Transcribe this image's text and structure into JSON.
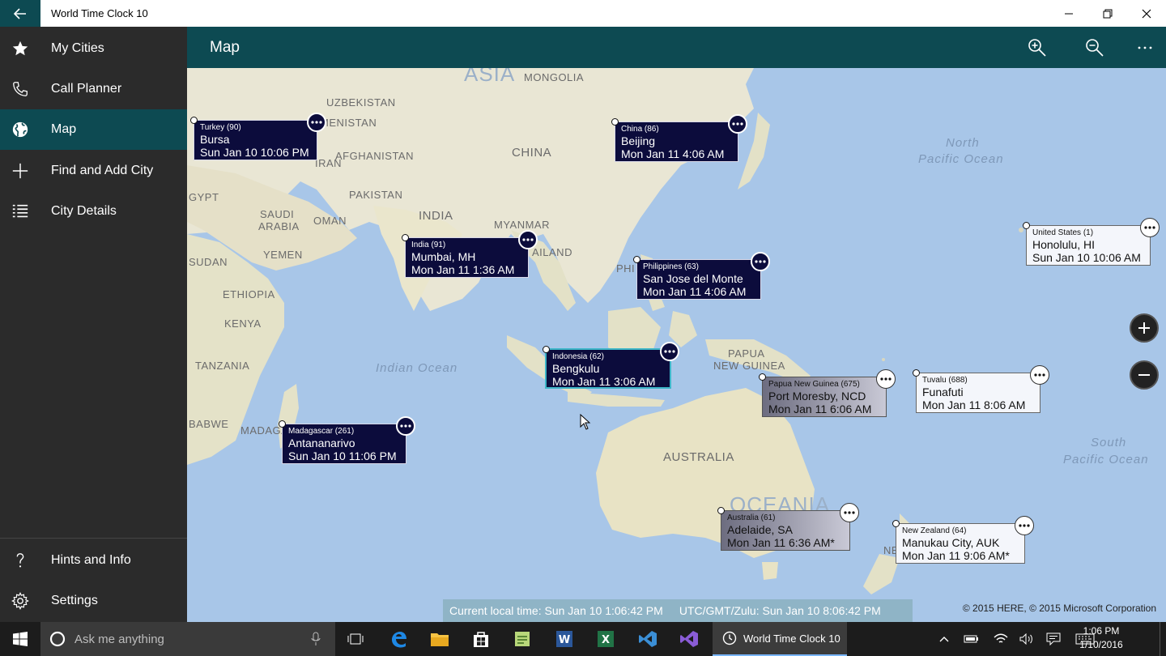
{
  "app": {
    "title": "World Time Clock 10"
  },
  "sidebar": {
    "items": [
      {
        "label": "My Cities",
        "icon": "star-icon"
      },
      {
        "label": "Call Planner",
        "icon": "phone-icon"
      },
      {
        "label": "Map",
        "icon": "globe-icon"
      },
      {
        "label": "Find and Add City",
        "icon": "plus-icon"
      },
      {
        "label": "City Details",
        "icon": "list-icon"
      }
    ],
    "bottom_items": [
      {
        "label": "Hints and Info",
        "icon": "question-icon"
      },
      {
        "label": "Settings",
        "icon": "gear-icon"
      }
    ]
  },
  "header": {
    "title": "Map"
  },
  "map_labels": {
    "asia": "ASIA",
    "mongolia": "MONGOLIA",
    "uzbekistan": "UZBEKISTAN",
    "turkmenistan": "MENISTAN",
    "afghanistan": "AFGHANISTAN",
    "iran": "IRAN",
    "china": "CHINA",
    "pakistan": "PAKISTAN",
    "india": "INDIA",
    "myanmar": "MYANMAR",
    "saudi": "SAUDI",
    "arabia": "ARABIA",
    "oman": "OMAN",
    "yemen": "YEMEN",
    "sudan": "SUDAN",
    "ethiopia": "ETHIOPIA",
    "kenya": "KENYA",
    "tanzania": "TANZANIA",
    "zimbabwe": "BABWE",
    "madagascar": "MADAGA",
    "thailand": "AILAND",
    "philippines": "PHI",
    "papua": "PAPUA",
    "new_guinea": "NEW GUINEA",
    "australia": "AUSTRALIA",
    "oceania": "OCEANIA",
    "new_zealand": "NEW",
    "egypt": "GYPT",
    "indian_ocean": "Indian Ocean",
    "north": "North",
    "pacific_ocean": "Pacific Ocean",
    "south": "South",
    "south_pacific": "Pacific Ocean"
  },
  "cities": [
    {
      "country": "Turkey (90)",
      "name": "Bursa",
      "time": "Sun Jan 10  10:06 PM",
      "style": "dark"
    },
    {
      "country": "China (86)",
      "name": "Beijing",
      "time": "Mon Jan 11  4:06 AM",
      "style": "dark"
    },
    {
      "country": "India (91)",
      "name": "Mumbai, MH",
      "time": "Mon Jan 11  1:36 AM",
      "style": "dark"
    },
    {
      "country": "Philippines (63)",
      "name": "San Jose del Monte",
      "time": "Mon Jan 11  4:06 AM",
      "style": "dark"
    },
    {
      "country": "United States (1)",
      "name": "Honolulu, HI",
      "time": "Sun Jan 10  10:06 AM",
      "style": "light"
    },
    {
      "country": "Indonesia (62)",
      "name": "Bengkulu",
      "time": "Mon Jan 11  3:06 AM",
      "style": "dark",
      "selected": true
    },
    {
      "country": "Papua New Guinea (675)",
      "name": "Port Moresby, NCD",
      "time": "Mon Jan 11  6:06 AM",
      "style": "gray"
    },
    {
      "country": "Tuvalu (688)",
      "name": "Funafuti",
      "time": "Mon Jan 11  8:06 AM",
      "style": "light"
    },
    {
      "country": "Madagascar (261)",
      "name": "Antananarivo",
      "time": "Sun Jan 10  11:06 PM",
      "style": "dark"
    },
    {
      "country": "Australia (61)",
      "name": "Adelaide, SA",
      "time": "Mon Jan 11  6:36 AM*",
      "style": "gray"
    },
    {
      "country": "New Zealand (64)",
      "name": "Manukau City, AUK",
      "time": "Mon Jan 11  9:06 AM*",
      "style": "light"
    }
  ],
  "status": {
    "local": "Current local time:  Sun Jan 10   1:06:42 PM",
    "utc": "UTC/GMT/Zulu:  Sun Jan 10  8:06:42 PM"
  },
  "copyright": "© 2015 HERE, © 2015 Microsoft Corporation",
  "taskbar": {
    "search_placeholder": "Ask me anything",
    "active_app": "World Time Clock 10",
    "time": "1:06 PM",
    "date": "1/10/2016"
  },
  "colors": {
    "accent": "#0d4a52",
    "sidebar": "#2b2b2b",
    "card_dark": "#0c0c3c",
    "ocean": "#a8c6e8",
    "land": "#e8e4d0"
  }
}
